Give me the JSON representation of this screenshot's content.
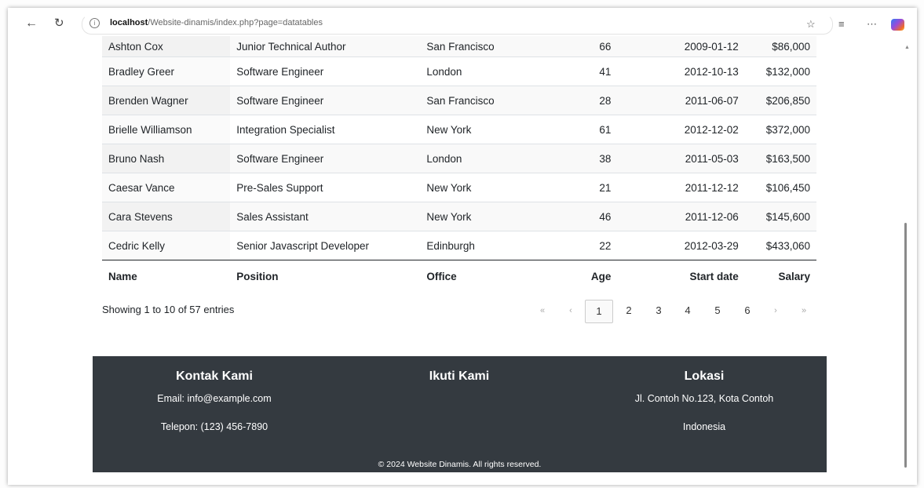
{
  "browser": {
    "back_icon": "arrow-left-icon",
    "reload_icon": "reload-icon",
    "url_host": "localhost",
    "url_path": "/Website-dinamis/index.php?page=datatables",
    "favorite_icon": "star-icon",
    "favorites_icon": "favorites-list-icon",
    "more_icon": "ellipsis-icon"
  },
  "table": {
    "columns": [
      "Name",
      "Position",
      "Office",
      "Age",
      "Start date",
      "Salary"
    ],
    "rows": [
      {
        "name": "Ashton Cox",
        "position": "Junior Technical Author",
        "office": "San Francisco",
        "age": "66",
        "start": "2009-01-12",
        "salary": "$86,000"
      },
      {
        "name": "Bradley Greer",
        "position": "Software Engineer",
        "office": "London",
        "age": "41",
        "start": "2012-10-13",
        "salary": "$132,000"
      },
      {
        "name": "Brenden Wagner",
        "position": "Software Engineer",
        "office": "San Francisco",
        "age": "28",
        "start": "2011-06-07",
        "salary": "$206,850"
      },
      {
        "name": "Brielle Williamson",
        "position": "Integration Specialist",
        "office": "New York",
        "age": "61",
        "start": "2012-12-02",
        "salary": "$372,000"
      },
      {
        "name": "Bruno Nash",
        "position": "Software Engineer",
        "office": "London",
        "age": "38",
        "start": "2011-05-03",
        "salary": "$163,500"
      },
      {
        "name": "Caesar Vance",
        "position": "Pre-Sales Support",
        "office": "New York",
        "age": "21",
        "start": "2011-12-12",
        "salary": "$106,450"
      },
      {
        "name": "Cara Stevens",
        "position": "Sales Assistant",
        "office": "New York",
        "age": "46",
        "start": "2011-12-06",
        "salary": "$145,600"
      },
      {
        "name": "Cedric Kelly",
        "position": "Senior Javascript Developer",
        "office": "Edinburgh",
        "age": "22",
        "start": "2012-03-29",
        "salary": "$433,060"
      }
    ],
    "info": "Showing 1 to 10 of 57 entries"
  },
  "pagination": {
    "first": "«",
    "prev": "‹",
    "pages": [
      "1",
      "2",
      "3",
      "4",
      "5",
      "6"
    ],
    "active": "1",
    "next": "›",
    "last": "»"
  },
  "footer": {
    "contact_title": "Kontak Kami",
    "email": "Email: info@example.com",
    "phone": "Telepon: (123) 456-7890",
    "follow_title": "Ikuti Kami",
    "location_title": "Lokasi",
    "address": "Jl. Contoh No.123, Kota Contoh",
    "country": "Indonesia",
    "copyright": "© 2024 Website Dinamis. All rights reserved.",
    "background_color": "#343a40"
  }
}
